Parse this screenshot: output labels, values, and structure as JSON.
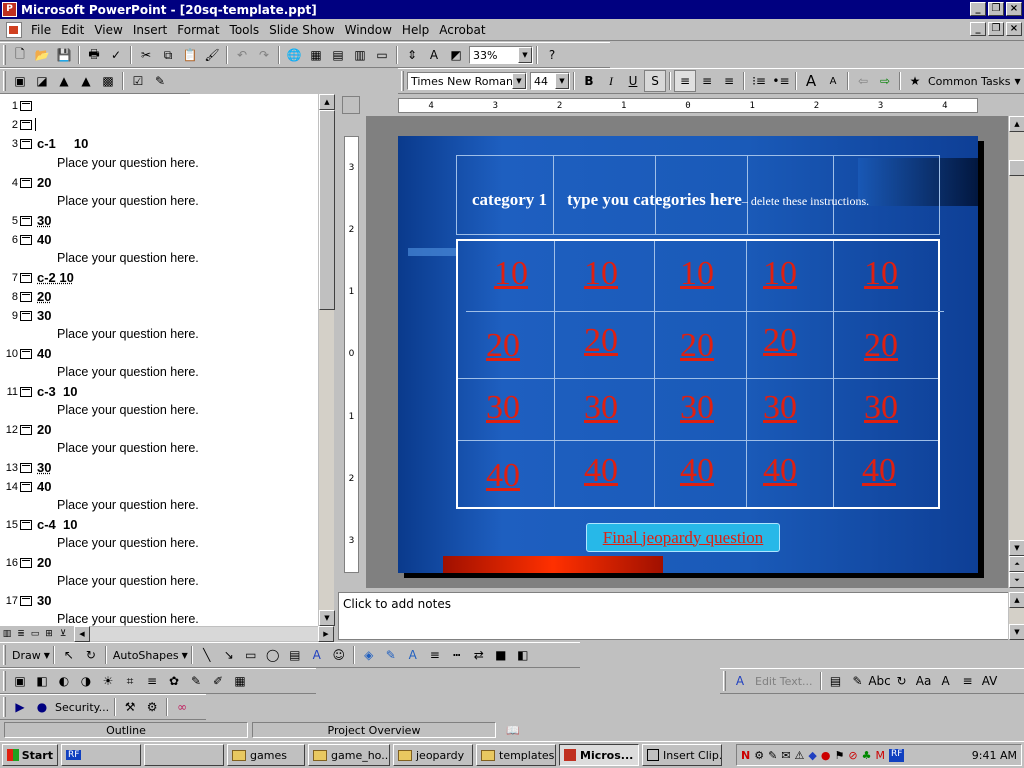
{
  "window": {
    "title": "Microsoft PowerPoint - [20sq-template.ppt]"
  },
  "menu": [
    "File",
    "Edit",
    "View",
    "Insert",
    "Format",
    "Tools",
    "Slide Show",
    "Window",
    "Help",
    "Acrobat"
  ],
  "toolbar": {
    "zoom": "33%",
    "font_name": "Times New Roman",
    "font_size": "44",
    "common_tasks": "Common Tasks"
  },
  "outline": [
    {
      "num": "1",
      "title": "",
      "body": []
    },
    {
      "num": "2",
      "title": "",
      "body": []
    },
    {
      "num": "3",
      "title": "c-1     10",
      "body": [
        "Place your question here."
      ]
    },
    {
      "num": "4",
      "title": "20",
      "body": [
        "Place your question here."
      ]
    },
    {
      "num": "5",
      "title": "30",
      "body": []
    },
    {
      "num": "6",
      "title": "40",
      "body": [
        "Place your question here."
      ]
    },
    {
      "num": "7",
      "title": "c-2 10",
      "body": []
    },
    {
      "num": "8",
      "title": "20",
      "body": []
    },
    {
      "num": "9",
      "title": "30",
      "body": [
        "Place your question here."
      ]
    },
    {
      "num": "10",
      "title": "40",
      "body": [
        "Place your question here."
      ]
    },
    {
      "num": "11",
      "title": "c-3  10",
      "body": [
        "Place your question here."
      ]
    },
    {
      "num": "12",
      "title": "20",
      "body": [
        "Place your question here."
      ]
    },
    {
      "num": "13",
      "title": "30",
      "body": []
    },
    {
      "num": "14",
      "title": "40",
      "body": [
        "Place your question here."
      ]
    },
    {
      "num": "15",
      "title": "c-4  10",
      "body": [
        "Place your question here."
      ]
    },
    {
      "num": "16",
      "title": "20",
      "body": [
        "Place your question here."
      ]
    },
    {
      "num": "17",
      "title": "30",
      "body": [
        "Place your question here."
      ]
    }
  ],
  "slide": {
    "category1": "category 1",
    "instructions_main": "type you categories here",
    "instructions_small": "– delete these instructions.",
    "rows": [
      [
        "10",
        "10",
        "10",
        "10",
        "10"
      ],
      [
        "20",
        "20",
        "20",
        "20",
        "20"
      ],
      [
        "30",
        "30",
        "30",
        "30",
        "30"
      ],
      [
        "40",
        "40",
        "40",
        "40",
        "40"
      ]
    ],
    "final_button": "Final jeopardy question"
  },
  "notes_placeholder": "Click to add notes",
  "draw_toolbar": {
    "draw": "Draw",
    "autoshapes": "AutoShapes",
    "edit_text": "Edit Text...",
    "security": "Security..."
  },
  "status": {
    "outline": "Outline",
    "project": "Project Overview"
  },
  "taskbar": {
    "start": "Start",
    "items": [
      "games",
      "game_ho...",
      "jeopardy",
      "templates",
      "Micros...",
      "Insert Clip..."
    ],
    "clock": "9:41 AM"
  }
}
